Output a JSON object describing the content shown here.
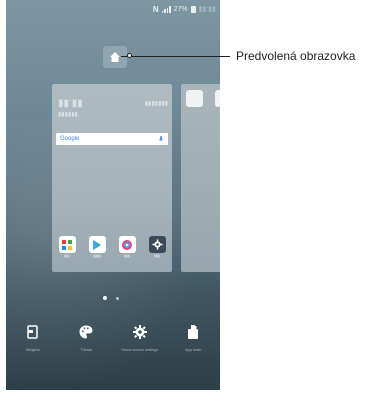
{
  "status_bar": {
    "nfc": "N",
    "battery": "27%"
  },
  "search": {
    "brand": "Google"
  },
  "apps": [
    {
      "name": "sms-app-icon",
      "bg": "#ffffff"
    },
    {
      "name": "play-store-icon",
      "bg": "#ffffff"
    },
    {
      "name": "camera-icon",
      "bg": "#ffffff"
    },
    {
      "name": "settings-icon",
      "bg": "#3b4a5a"
    }
  ],
  "bottom_bar": {
    "widgets": "Widgets",
    "theme": "Theme",
    "home_settings": "Home screen settings",
    "app_trash": "App trash"
  },
  "callout": {
    "label": "Predvolená obrazovka"
  }
}
